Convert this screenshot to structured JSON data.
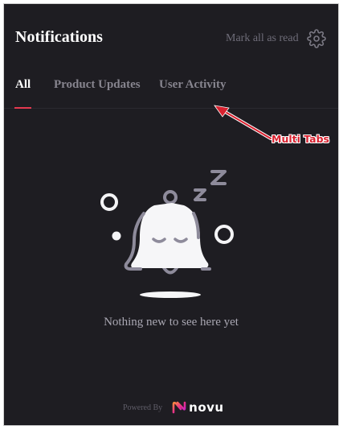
{
  "header": {
    "title": "Notifications",
    "mark_all_read": "Mark all as read",
    "settings_icon": "gear-icon"
  },
  "tabs": [
    {
      "label": "All",
      "selected": true
    },
    {
      "label": "Product Updates",
      "selected": false
    },
    {
      "label": "User Activity",
      "selected": false
    }
  ],
  "empty_state": {
    "illustration_icon": "sleeping-bell-icon",
    "message": "Nothing new to see here yet"
  },
  "footer": {
    "powered_by": "Powered By",
    "brand": "novu",
    "logo_icon": "novu-logo-icon"
  },
  "annotation": {
    "label": "Multi Tabs"
  },
  "colors": {
    "panel_background": "#1e1d22",
    "active_tab_underline": "#e43950",
    "annotation_red": "#d8212f"
  }
}
